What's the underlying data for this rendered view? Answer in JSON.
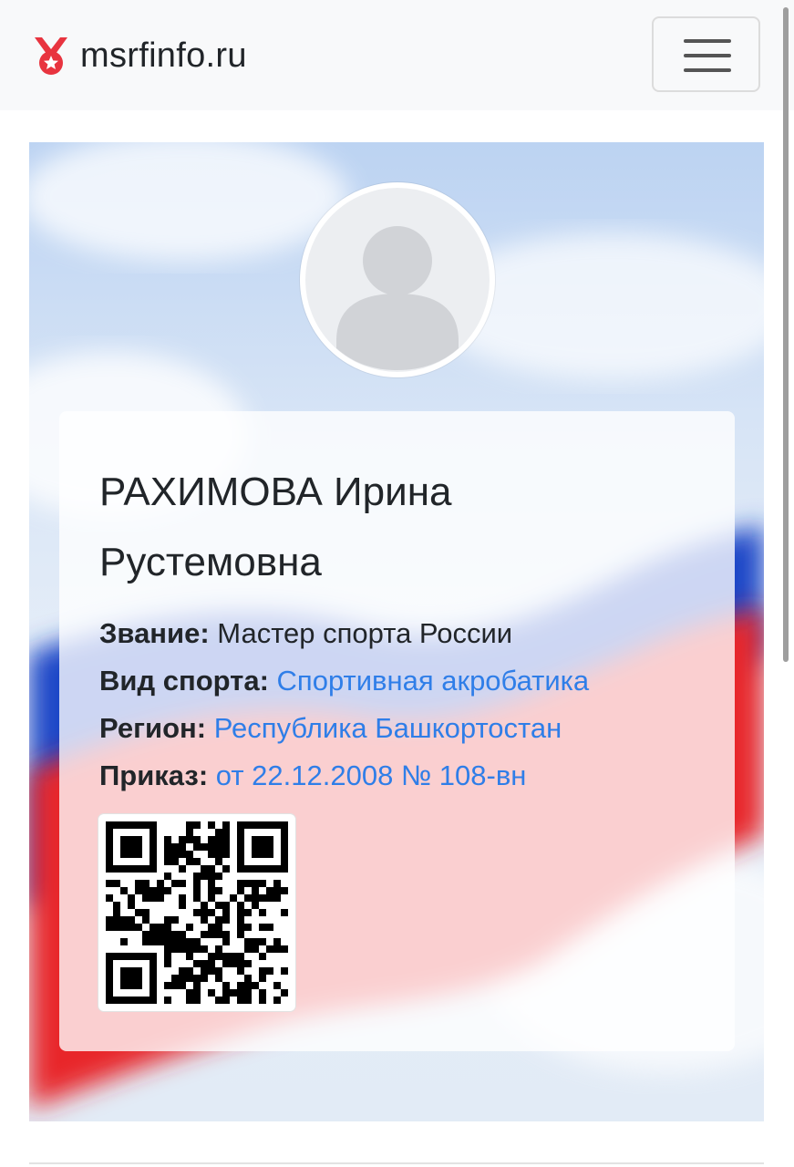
{
  "navbar": {
    "brand_text": "msrfinfo.ru",
    "brand_icon": "medal-star-icon",
    "menu_icon": "hamburger-menu-icon"
  },
  "profile": {
    "name_line1": "РАХИМОВА Ирина",
    "name_line2": "Рустемовна",
    "avatar_icon": "user-placeholder-icon",
    "title_label": "Звание:",
    "title_value": "Мастер спорта России",
    "sport_label": "Вид спорта:",
    "sport_value": "Спортивная акробатика",
    "region_label": "Регион:",
    "region_value": "Республика Башкортостан",
    "order_label": "Приказ:",
    "order_value": "от 22.12.2008 № 108-вн",
    "qr_icon": "qr-code-icon"
  },
  "colors": {
    "brand_red": "#e8343f",
    "link_blue": "#2f7ee8",
    "text_dark": "#212529",
    "flag_white": "#ffffff",
    "flag_blue": "#1f47c7",
    "flag_red": "#e8252c"
  }
}
